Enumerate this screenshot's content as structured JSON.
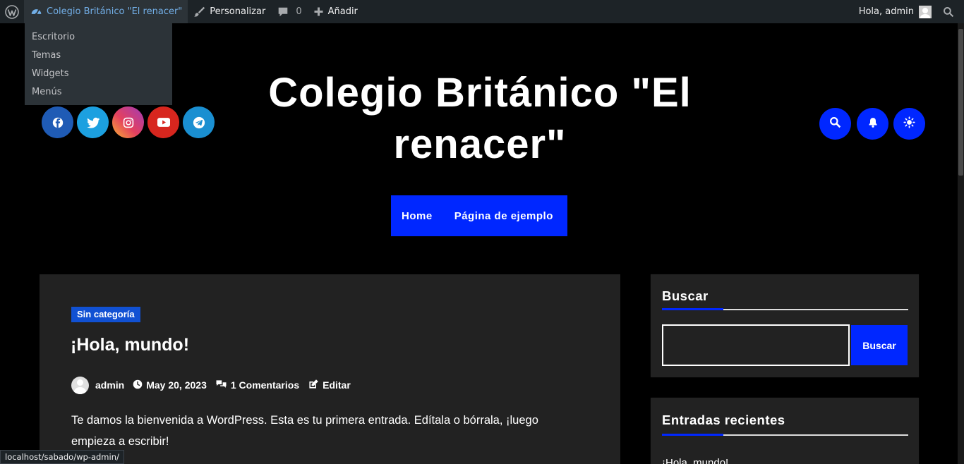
{
  "admin_bar": {
    "site_name": "Colegio Británico \"El renacer\"",
    "customize": "Personalizar",
    "comments_count": "0",
    "add_new": "Añadir",
    "greeting": "Hola, admin"
  },
  "site_menu": {
    "items": [
      "Escritorio",
      "Temas",
      "Widgets",
      "Menús"
    ]
  },
  "header": {
    "site_title": "Colegio Británico \"El renacer\"",
    "social_icons": [
      "facebook-icon",
      "twitter-icon",
      "instagram-icon",
      "youtube-icon",
      "telegram-icon"
    ],
    "action_icons": [
      "search-icon",
      "bell-icon",
      "sun-icon"
    ]
  },
  "nav": {
    "items": [
      "Home",
      "Página de ejemplo"
    ]
  },
  "post": {
    "category": "Sin categoría",
    "title": "¡Hola, mundo!",
    "author": "admin",
    "date": "May 20, 2023",
    "comments": "1 Comentarios",
    "edit": "Editar",
    "excerpt": "Te damos la bienvenida a WordPress. Esta es tu primera entrada. Edítala o bórrala, ¡luego empieza a escribir!"
  },
  "sidebar": {
    "search_title": "Buscar",
    "search_value": "",
    "search_button": "Buscar",
    "recent_title": "Entradas recientes",
    "recent_items": [
      "¡Hola, mundo!"
    ]
  },
  "status_url": "localhost/sabado/wp-admin/",
  "colors": {
    "accent": "#0027ff",
    "admin_bar": "#1d2327",
    "card": "#222222",
    "category_badge": "#1151d3",
    "facebook": "#1f5bb5",
    "twitter": "#1ca0e0",
    "youtube": "#d7261e",
    "telegram": "#1a8fd1"
  }
}
